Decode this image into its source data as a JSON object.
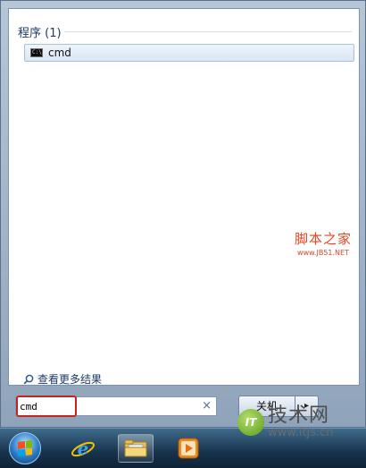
{
  "results": {
    "group_header": "程序 (1)",
    "items": [
      {
        "label": "cmd",
        "icon": "cmd-console-icon"
      }
    ]
  },
  "see_more": {
    "label": "查看更多结果",
    "icon": "search-icon"
  },
  "search": {
    "value": "cmd",
    "clear_icon": "×"
  },
  "shutdown": {
    "label": "关机",
    "arrow": "▸"
  },
  "taskbar": {
    "apps": [
      {
        "name": "internet-explorer",
        "icon": "ie-icon"
      },
      {
        "name": "windows-explorer",
        "icon": "folder-icon"
      },
      {
        "name": "media-player",
        "icon": "media-player-icon"
      }
    ]
  },
  "watermarks": {
    "jb51_main": "脚本之家",
    "jb51_sub": "www.JB51.NET",
    "itjs_badge": "IT",
    "itjs_main": "技术网",
    "itjs_url": "www.itjs.cn"
  },
  "colors": {
    "accent": "#1e3a66",
    "highlight_border": "#c42323",
    "taskbar": "#17334c"
  }
}
